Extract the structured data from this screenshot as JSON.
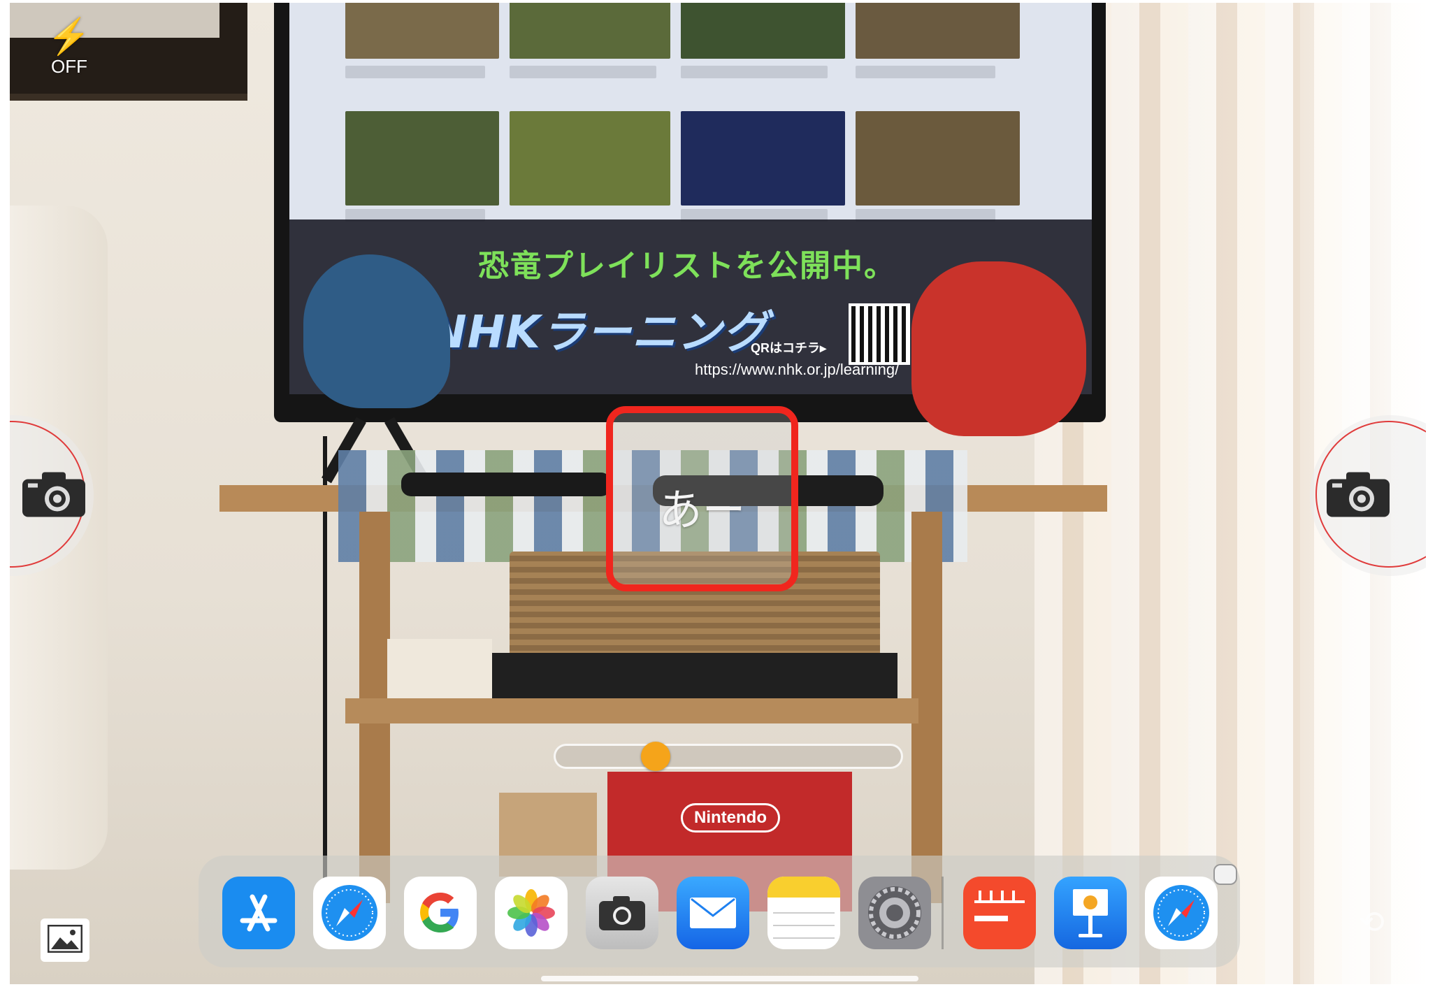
{
  "flash": {
    "icon": "lightning-bolt-icon",
    "bolt_glyph": "⚡",
    "label": "OFF"
  },
  "highlight": {
    "text": "あー",
    "color": "#f0261e"
  },
  "shutter_left": {
    "icon": "camera-icon"
  },
  "shutter_right": {
    "icon": "camera-icon"
  },
  "zoom_slider": {
    "value": 0.27
  },
  "gallery": {
    "icon": "photo-library-icon"
  },
  "tv": {
    "banner_title": "恐竜プレイリストを公開中。",
    "logo": "NHKラーニング",
    "url": "https://www.nhk.or.jp/learning/",
    "qr_label": "QRはコチラ▸"
  },
  "box_label": "Nintendo",
  "dock": {
    "apps": [
      {
        "name": "App Store",
        "icon": "app-store-icon",
        "bg": "#1a8cf0"
      },
      {
        "name": "Safari",
        "icon": "safari-icon",
        "bg": "#ffffff"
      },
      {
        "name": "Google",
        "icon": "google-icon",
        "bg": "#ffffff"
      },
      {
        "name": "Photos",
        "icon": "photos-icon",
        "bg": "#ffffff"
      },
      {
        "name": "Camera",
        "icon": "camera-app-icon",
        "bg": "#d9d9d9"
      },
      {
        "name": "Mail",
        "icon": "mail-icon",
        "bg": "#1e8ff5"
      },
      {
        "name": "Notes",
        "icon": "notes-icon",
        "bg": "#ffffff"
      },
      {
        "name": "Settings",
        "icon": "settings-icon",
        "bg": "#8e8e93"
      },
      {
        "name": "Calendar",
        "icon": "calendar-icon",
        "bg": "#f44a2c"
      },
      {
        "name": "Keynote",
        "icon": "keynote-icon",
        "bg": "#1e8ff5"
      },
      {
        "name": "Safari",
        "icon": "safari-icon",
        "bg": "#ffffff"
      }
    ]
  }
}
